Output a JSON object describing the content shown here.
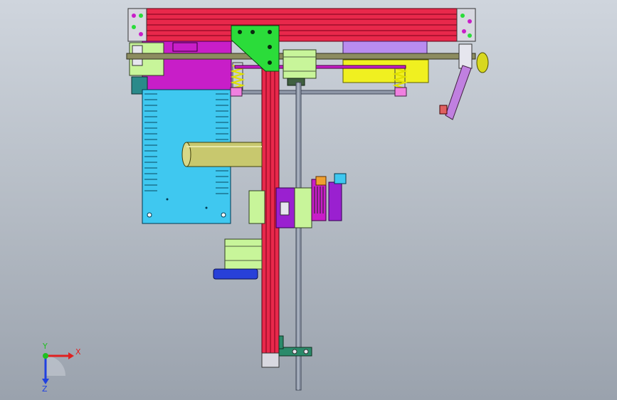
{
  "viewport": {
    "background_top": "#cfd5dd",
    "background_bottom": "#9aa2ad"
  },
  "colors": {
    "profile_red": "#e8284b",
    "frame_magenta": "#c81ec8",
    "plate_green": "#2bdc3a",
    "motor_green": "#c8f59a",
    "psu_cyan": "#3fc8f0",
    "bar_yellow": "#f0f020",
    "lavender": "#b98cf0",
    "rod_gray": "#8f98a8",
    "carriage_purple": "#9a20d0",
    "cylinder_olive": "#c8c86e",
    "bracket_blue": "#2840d8"
  },
  "model": {
    "parts": [
      "aluminum-extrusion-top",
      "aluminum-extrusion-vertical",
      "corner-gusset-plate",
      "power-supply-unit",
      "stepper-motor-top",
      "stepper-motor-lower",
      "stepper-motor-carriage",
      "linear-guide-rod",
      "spring-left",
      "spring-right",
      "spool-holder-cylinder",
      "print-head-carriage",
      "filament-arm"
    ]
  },
  "triad": {
    "x_label": "X",
    "y_label": "Y",
    "z_label": "Z",
    "x_color": "#e02020",
    "y_color": "#20c020",
    "z_color": "#2040e0"
  }
}
